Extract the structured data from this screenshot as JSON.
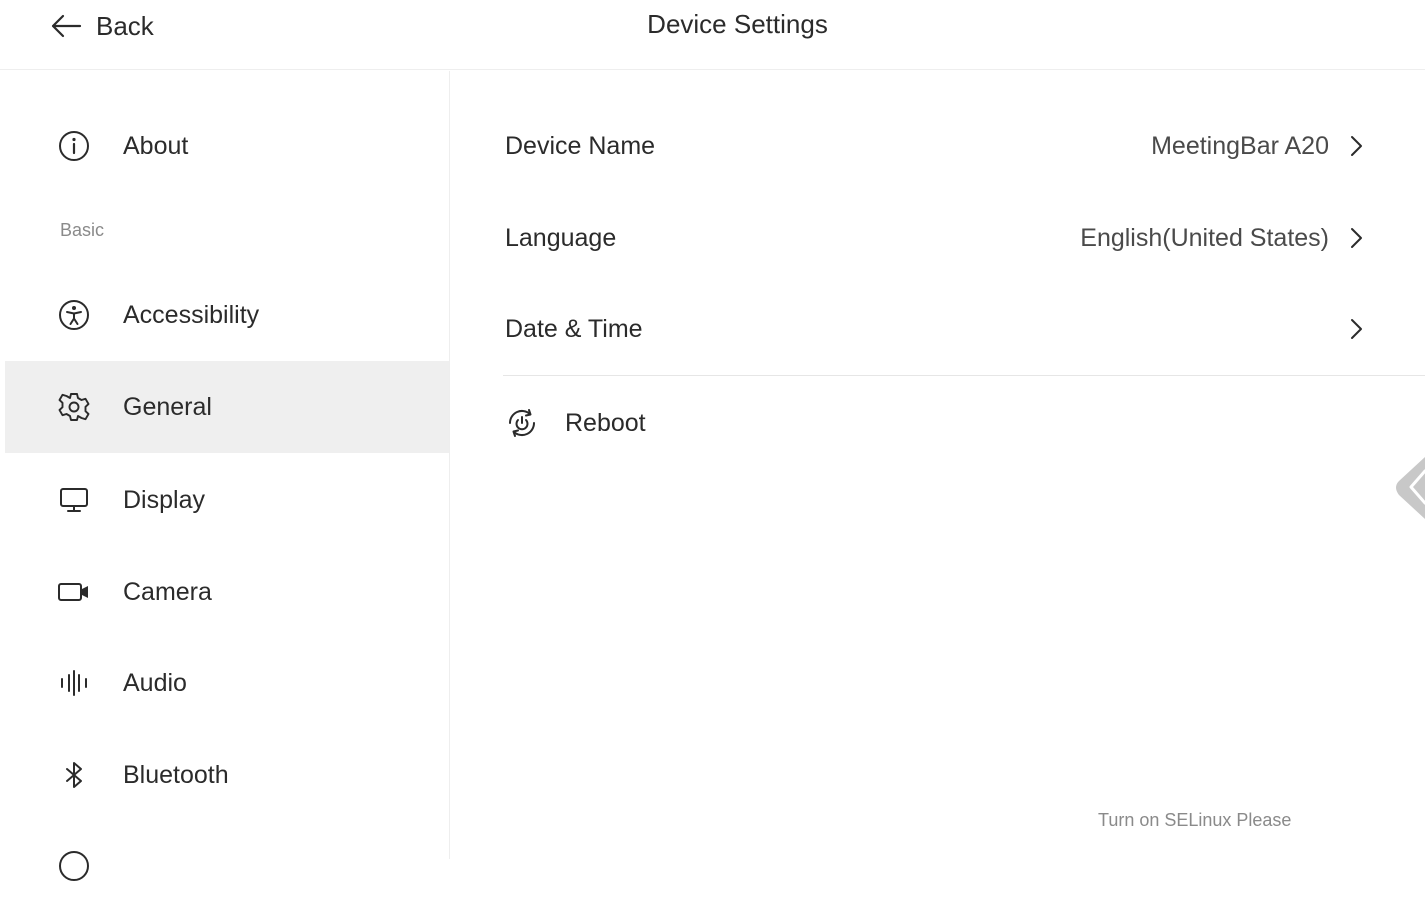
{
  "header": {
    "back_label": "Back",
    "title": "Device Settings"
  },
  "sidebar": {
    "section_basic": "Basic",
    "items": [
      {
        "label": "About",
        "icon": "info-icon"
      },
      {
        "label": "Accessibility",
        "icon": "accessibility-icon"
      },
      {
        "label": "General",
        "icon": "gear-icon",
        "active": true
      },
      {
        "label": "Display",
        "icon": "monitor-icon"
      },
      {
        "label": "Camera",
        "icon": "camera-icon"
      },
      {
        "label": "Audio",
        "icon": "audio-waveform-icon"
      },
      {
        "label": "Bluetooth",
        "icon": "bluetooth-icon"
      }
    ]
  },
  "main": {
    "rows": [
      {
        "label": "Device Name",
        "value": "MeetingBar A20"
      },
      {
        "label": "Language",
        "value": "English(United States)"
      },
      {
        "label": "Date & Time",
        "value": ""
      }
    ],
    "reboot_label": "Reboot",
    "footer_note": "Turn on SELinux Please"
  },
  "colors": {
    "active_bg": "#efefef",
    "divider": "#eeeeee",
    "text": "#2b2b2b",
    "muted": "#8a8a8a"
  }
}
